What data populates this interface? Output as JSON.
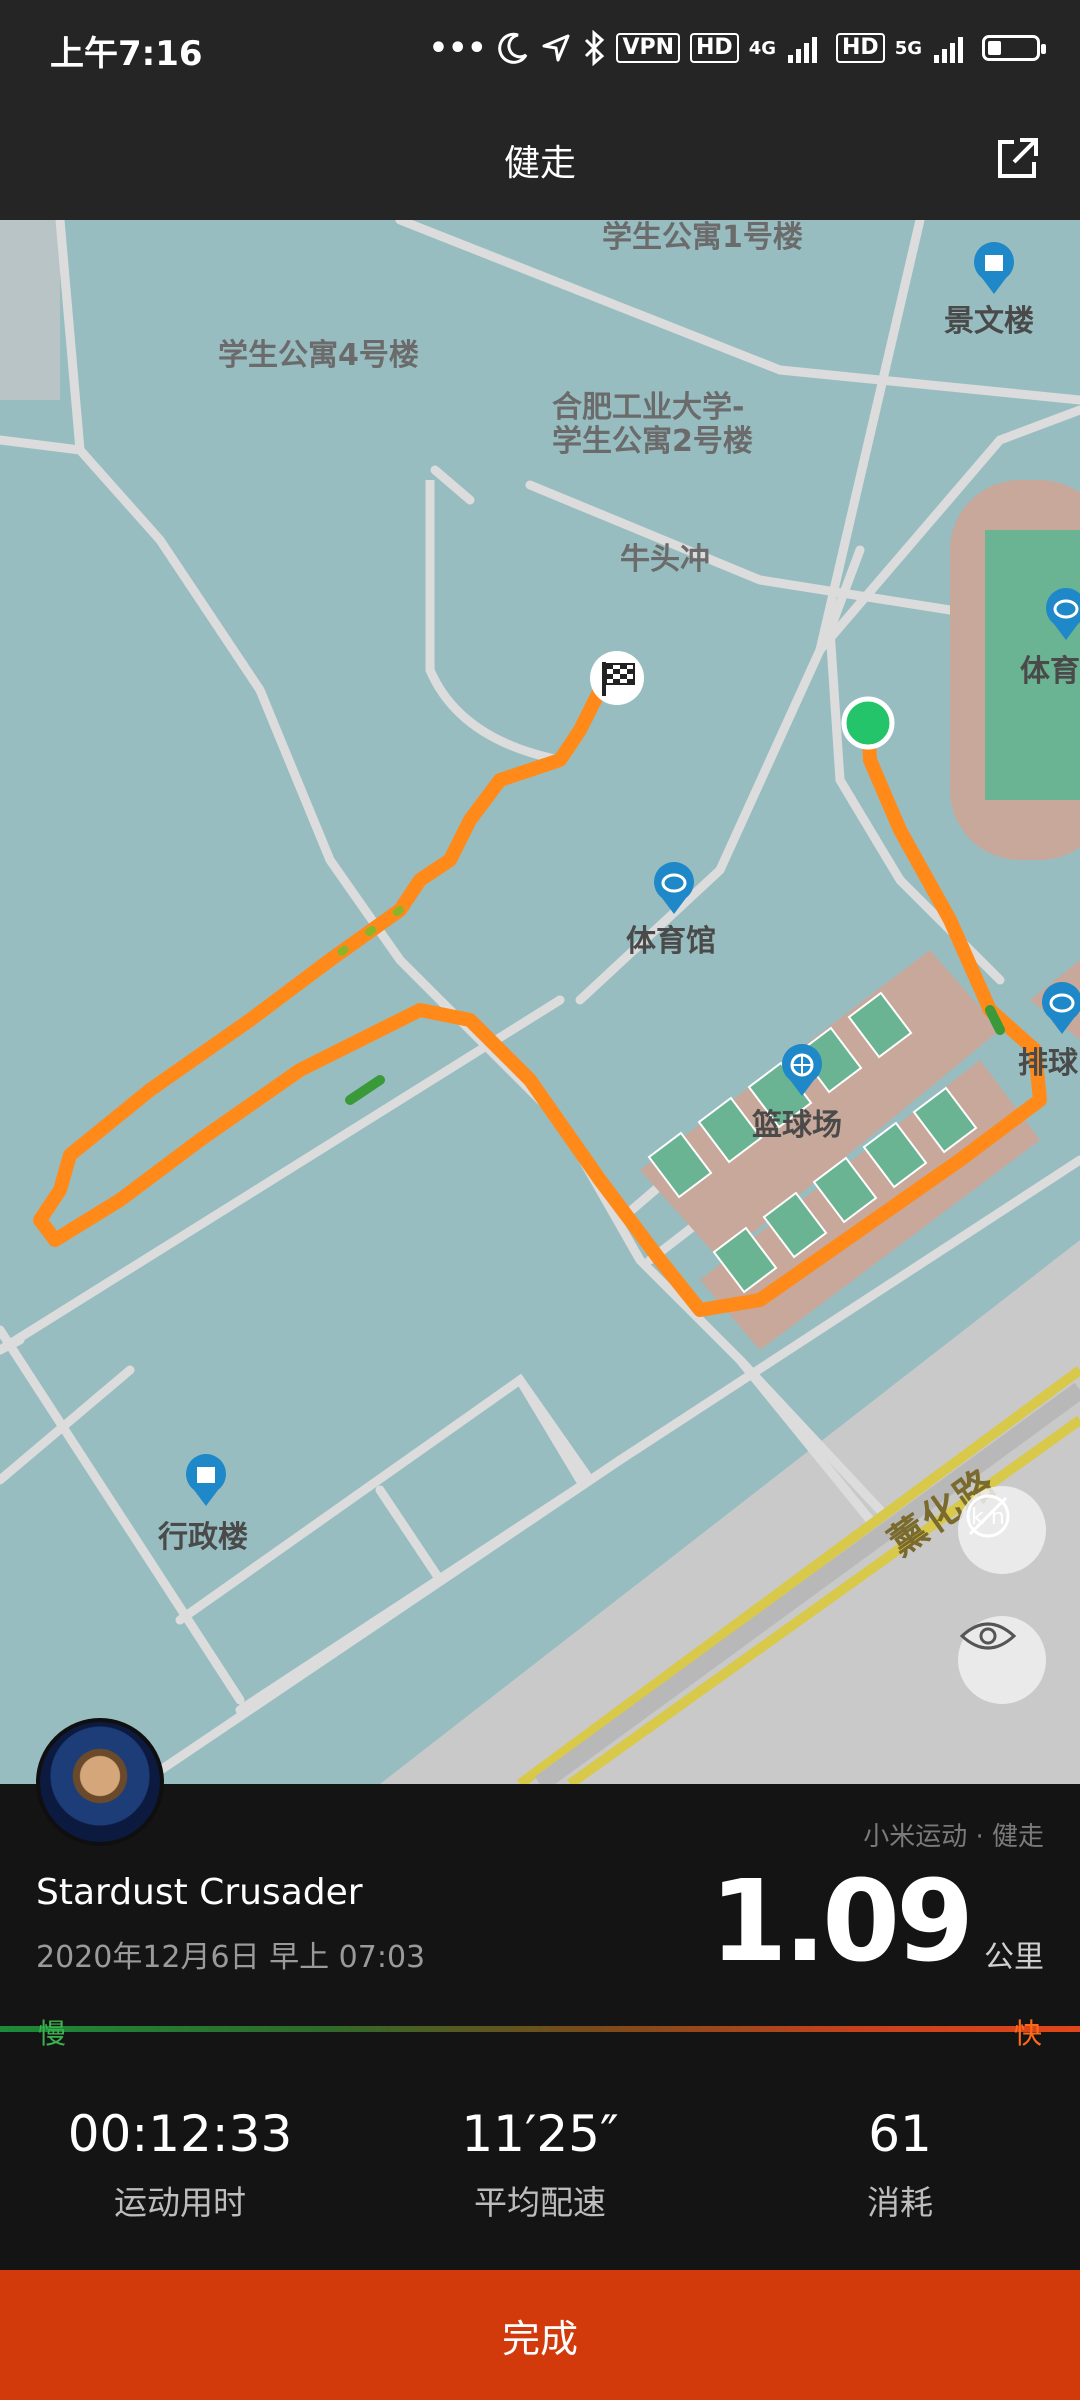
{
  "status_bar": {
    "time": "上午7:16",
    "vpn": "VPN",
    "hd1": "HD",
    "net1": "4G",
    "hd2": "HD",
    "net2": "5G",
    "battery_level": 0.25
  },
  "header": {
    "title": "健走"
  },
  "map": {
    "labels": {
      "dorm1": "学生公寓1号楼",
      "jingwen": "景文楼",
      "dorm4": "学生公寓4号楼",
      "university": "合肥工业大学-",
      "dorm2": "学生公寓2号楼",
      "niutouchong": "牛头冲",
      "stadium_right": "体育",
      "gym": "体育馆",
      "basketball": "篮球场",
      "volleyball": "排球",
      "admin": "行政楼",
      "road": "薰化路"
    },
    "colors": {
      "water": "#98bdc1",
      "road": "#d8d8d8",
      "track": "#ff8a1a",
      "start": "#23c46a",
      "court": "#c7a89a",
      "field": "#6ab494",
      "arterial": "#d8c94a"
    }
  },
  "result": {
    "source": "小米运动 · 健走",
    "user": "Stardust Crusader",
    "datetime": "2020年12月6日 早上 07:03",
    "distance": "1.09",
    "distance_unit": "公里",
    "slow_label": "慢",
    "fast_label": "快"
  },
  "stats": [
    {
      "value": "00:12:33",
      "label": "运动用时"
    },
    {
      "value": "11′25″",
      "label": "平均配速"
    },
    {
      "value": "61",
      "label": "消耗"
    }
  ],
  "done_button": "完成"
}
